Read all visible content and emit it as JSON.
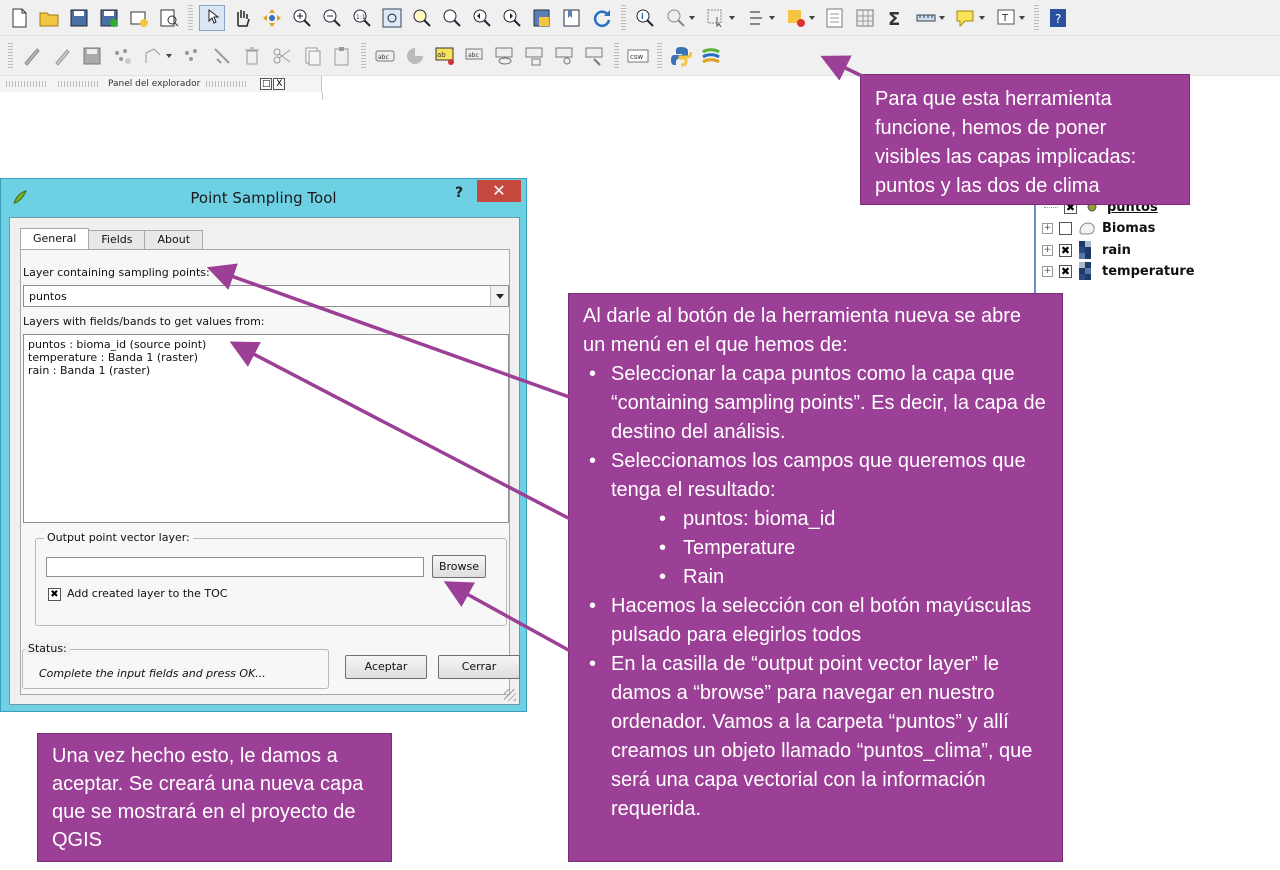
{
  "toolbar_row1": {
    "icons": [
      "new-file-icon",
      "open-folder-icon",
      "save-icon",
      "save-as-icon",
      "new-print-composer-icon",
      "composer-manager-icon",
      "touch-select-icon",
      "pan-hand-icon",
      "pan-to-selection-icon",
      "zoom-in-icon",
      "zoom-out-icon",
      "zoom-native-icon",
      "zoom-full-icon",
      "zoom-to-selection-icon",
      "zoom-to-layer-icon",
      "zoom-last-icon",
      "zoom-next-icon",
      "new-bookmark-icon",
      "show-bookmarks-icon",
      "refresh-icon",
      "identify-icon",
      "map-tips-icon",
      "select-features-icon",
      "deselect-icon",
      "attribute-table-icon",
      "statistics-icon",
      "field-calculator-icon",
      "sum-icon",
      "measure-icon",
      "annotation-icon",
      "text-annotation-icon",
      "help-icon"
    ]
  },
  "toolbar_row2": {
    "icons": [
      "current-edits-icon",
      "toggle-editing-icon",
      "save-edits-icon",
      "add-feature-icon",
      "move-feature-icon",
      "node-tool-icon",
      "delete-selected-icon",
      "cut-features-icon",
      "copy-features-icon",
      "paste-features-icon",
      "label-icon",
      "pin-labels-icon",
      "highlight-labels-icon",
      "move-label-icon",
      "show-hide-labels-icon",
      "rotate-label-icon",
      "change-label-icon",
      "csw-icon",
      "python-console-icon",
      "point-sampling-tool-icon"
    ],
    "csw_label": "csw",
    "abc_label": "abc"
  },
  "explorer": {
    "label": "Panel del explorador",
    "float_btn": "□",
    "close_btn": "X"
  },
  "callouts": {
    "top": "Para que esta herramienta funcione, hemos de poner visibles las capas implicadas: puntos y las dos de clima",
    "right": {
      "intro": "Al darle al botón de la herramienta nueva se abre un menú en el que hemos de:",
      "b1": "Seleccionar la capa puntos como la capa que “containing sampling points”. Es decir, la capa de destino del análisis.",
      "b2": "Seleccionamos los campos que queremos que tenga el resultado:",
      "sub1": "puntos: bioma_id",
      "sub2": "Temperature",
      "sub3": "Rain",
      "b3": "Hacemos la selección con el botón mayúsculas pulsado para elegirlos todos",
      "b4": "En la casilla de “output point vector layer” le damos a “browse” para navegar en nuestro ordenador. Vamos a la carpeta “puntos” y allí creamos un objeto llamado “puntos_clima”, que será una capa vectorial con la información requerida."
    },
    "bottom": "Una vez hecho esto, le damos a aceptar. Se creará una nueva capa que se mostrará en el proyecto de QGIS"
  },
  "layers": [
    {
      "name": "puntos",
      "checked": true,
      "check_mark": "✖",
      "icon": "point-layer-icon"
    },
    {
      "name": "Biomas",
      "checked": false,
      "check_mark": "",
      "icon": "polygon-layer-icon"
    },
    {
      "name": "rain",
      "checked": true,
      "check_mark": "✖",
      "icon": "raster-layer-icon"
    },
    {
      "name": "temperature",
      "checked": true,
      "check_mark": "✖",
      "icon": "raster-layer-icon"
    }
  ],
  "dialog": {
    "title": "Point Sampling Tool",
    "help": "?",
    "close": "✕",
    "tabs": [
      "General",
      "Fields",
      "About"
    ],
    "sampling_label": "Layer containing sampling points:",
    "sampling_value": "puntos",
    "fields_label": "Layers with fields/bands to get values from:",
    "fields": [
      "puntos : bioma_id (source point)",
      "temperature : Banda 1 (raster)",
      "rain : Banda 1 (raster)"
    ],
    "output_label": "Output point vector layer:",
    "output_value": "",
    "browse": "Browse",
    "add_toc_label": "Add created layer to the TOC",
    "add_toc_checked": true,
    "add_toc_mark": "✖",
    "status_label": "Status:",
    "status_text": "Complete the input fields and press OK...",
    "accept": "Aceptar",
    "cancel": "Cerrar"
  },
  "colors": {
    "callout_bg": "#9c3f96",
    "arrow": "#9c3f96",
    "dialog_frame": "#6ed0e3",
    "close_red": "#c7483f"
  }
}
